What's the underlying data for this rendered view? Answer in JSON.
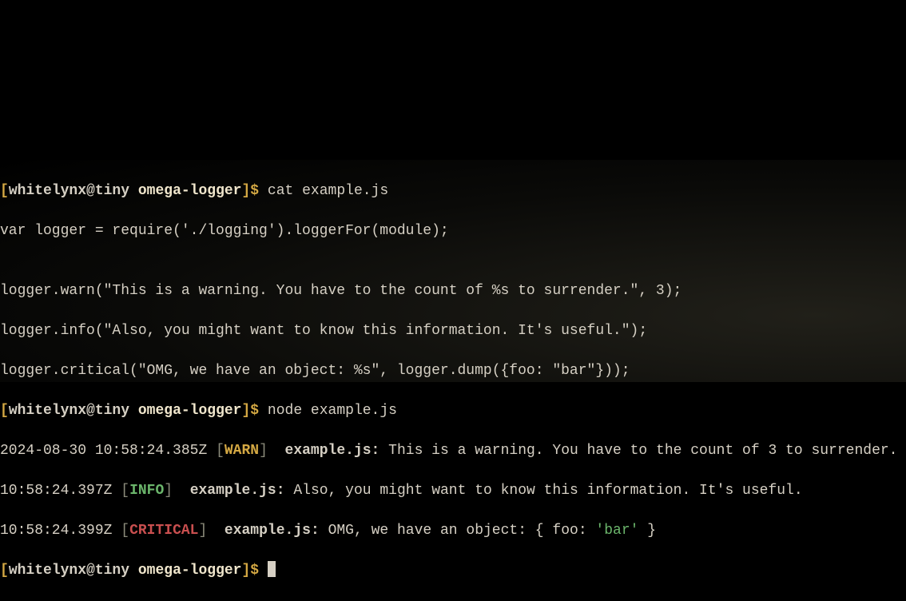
{
  "prompt": {
    "open_bracket": "[",
    "user_host": "whitelynx@tiny",
    "cwd": "omega-logger",
    "close_bracket": "]",
    "dollar": "$"
  },
  "cmd1": "cat example.js",
  "src": {
    "l1": "var logger = require('./logging').loggerFor(module);",
    "l2": "",
    "l3": "logger.warn(\"This is a warning. You have to the count of %s to surrender.\", 3);",
    "l4": "logger.info(\"Also, you might want to know this information. It's useful.\");",
    "l5": "logger.critical(\"OMG, we have an object: %s\", logger.dump({foo: \"bar\"}));"
  },
  "cmd2": "node example.js",
  "log": {
    "row1": {
      "ts": "2024-08-30 10:58:24.385Z",
      "level": "WARN",
      "source": "example.js",
      "msg": "This is a warning. You have to the count of 3 to surrender."
    },
    "row2": {
      "ts": "10:58:24.397Z",
      "level": "INFO",
      "source": "example.js",
      "msg": "Also, you might want to know this information. It's useful."
    },
    "row3": {
      "ts": "10:58:24.399Z",
      "level": "CRITICAL",
      "source": "example.js",
      "msg_pre": "OMG, we have an object: { foo: ",
      "msg_lit": "'bar'",
      "msg_post": " }"
    }
  },
  "brackets": {
    "open": "[",
    "close": "]"
  },
  "colon": ":"
}
